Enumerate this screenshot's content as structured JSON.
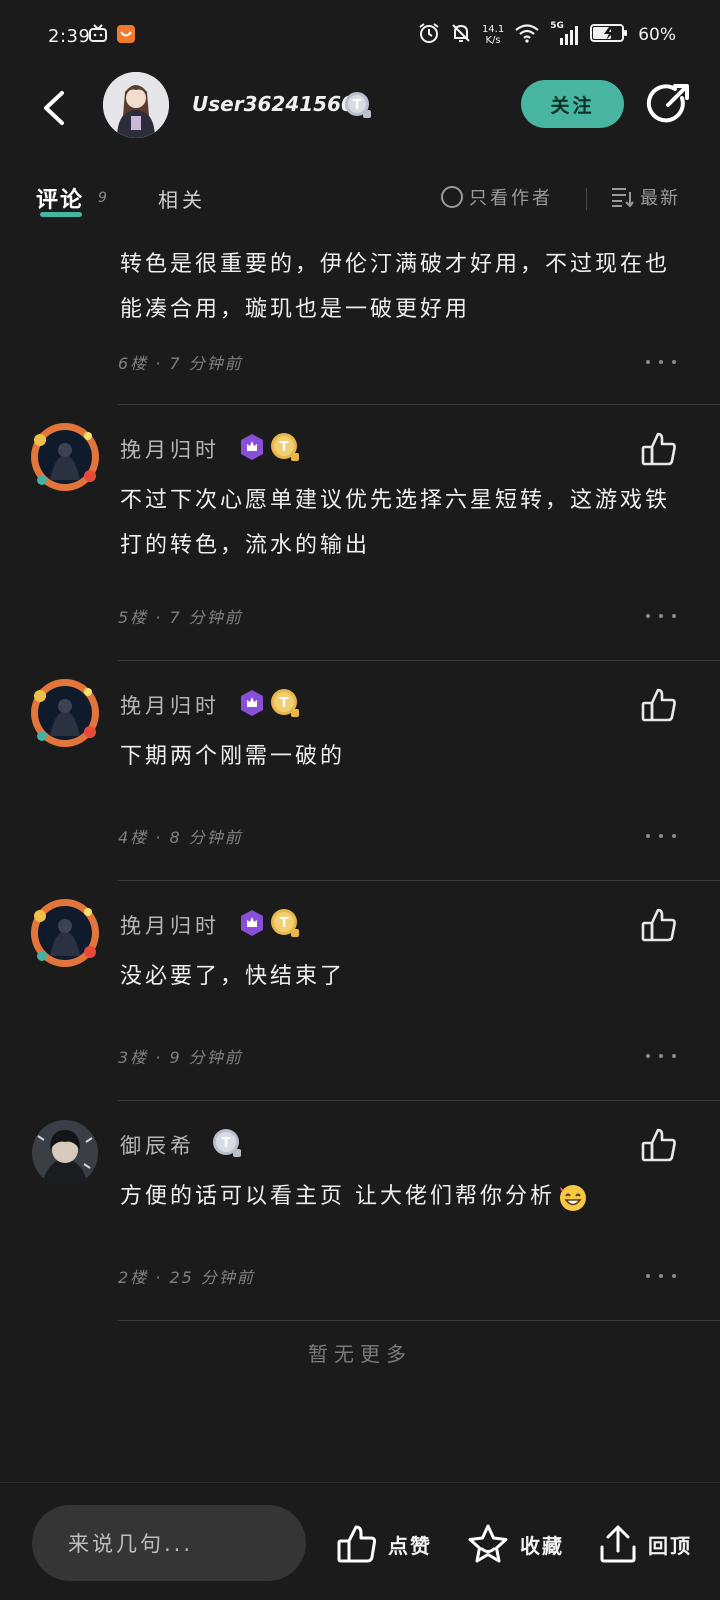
{
  "status_bar": {
    "time": "2:39",
    "net_speed_value": "14.1",
    "net_speed_unit": "K/s",
    "signal_label": "5G",
    "battery": "60%"
  },
  "header": {
    "username": "User362415602",
    "follow_label": "关注"
  },
  "tabs": {
    "comments_label": "评论",
    "comments_count": "9",
    "related_label": "相关",
    "author_only_label": "只看作者",
    "sort_label": "最新"
  },
  "comments": [
    {
      "text": "转色是很重要的，伊伦汀满破才好用，不过现在也能凑合用，璇玑也是一破更好用",
      "meta": "6楼 · 7 分钟前"
    },
    {
      "author": "挽月归时",
      "text": "不过下次心愿单建议优先选择六星短转，这游戏铁打的转色，流水的输出",
      "meta": "5楼 · 7 分钟前"
    },
    {
      "author": "挽月归时",
      "text": "下期两个刚需一破的",
      "meta": "4楼 · 8 分钟前"
    },
    {
      "author": "挽月归时",
      "text": "没必要了，快结束了",
      "meta": "3楼 · 9 分钟前"
    },
    {
      "author": "御辰希",
      "text": "方便的话可以看主页 让大佬们帮你分析",
      "meta": "2楼 · 25 分钟前"
    }
  ],
  "no_more_label": "暂无更多",
  "bottom_bar": {
    "input_placeholder": "来说几句...",
    "like_label": "点赞",
    "favorite_label": "收藏",
    "top_label": "回顶"
  },
  "colors": {
    "background": "#1b1b1c",
    "accent": "#48b5a0",
    "level_badge": "#8a4fd8",
    "title_badge_gold": "#e8b64a",
    "title_badge_gray": "#b9c0cc"
  }
}
